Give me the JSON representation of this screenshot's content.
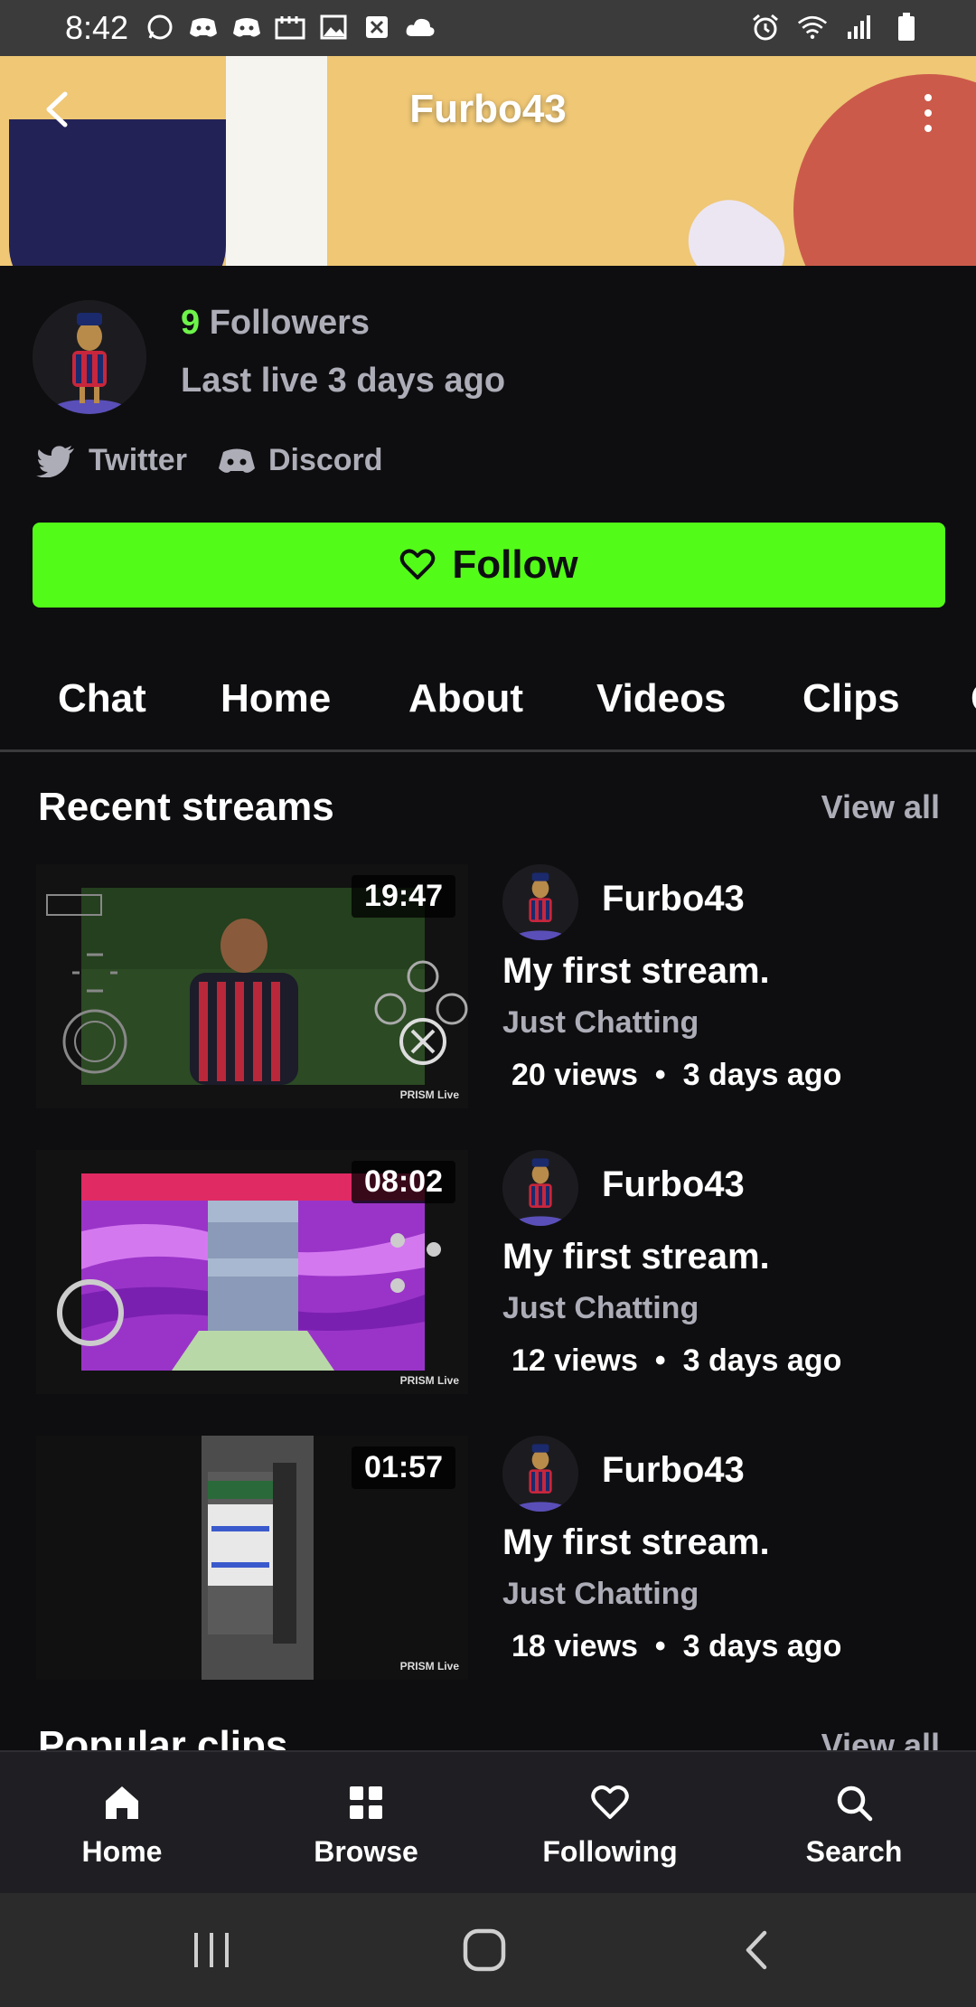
{
  "status_bar": {
    "time": "8:42"
  },
  "header": {
    "title": "Furbo43"
  },
  "profile": {
    "followers_count": "9",
    "followers_label": "Followers",
    "last_live": "Last live 3 days ago",
    "socials": [
      {
        "label": "Twitter",
        "icon": "twitter-icon"
      },
      {
        "label": "Discord",
        "icon": "discord-icon"
      }
    ],
    "follow_label": "Follow"
  },
  "tabs": [
    {
      "label": "Chat"
    },
    {
      "label": "Home"
    },
    {
      "label": "About"
    },
    {
      "label": "Videos"
    },
    {
      "label": "Clips"
    },
    {
      "label": "C"
    }
  ],
  "recent_streams": {
    "title": "Recent streams",
    "view_all": "View all",
    "items": [
      {
        "duration": "19:47",
        "channel": "Furbo43",
        "title": "My first stream.",
        "category": "Just Chatting",
        "views": "20 views",
        "age": "3 days ago",
        "watermark": "PRISM Live"
      },
      {
        "duration": "08:02",
        "channel": "Furbo43",
        "title": "My first stream.",
        "category": "Just Chatting",
        "views": "12 views",
        "age": "3 days ago",
        "watermark": "PRISM Live"
      },
      {
        "duration": "01:57",
        "channel": "Furbo43",
        "title": "My first stream.",
        "category": "Just Chatting",
        "views": "18 views",
        "age": "3 days ago",
        "watermark": "PRISM Live"
      }
    ]
  },
  "next_section": {
    "title": "Popular clips",
    "view_all": "View all"
  },
  "bottom_nav": [
    {
      "label": "Home",
      "icon": "home-icon"
    },
    {
      "label": "Browse",
      "icon": "browse-icon"
    },
    {
      "label": "Following",
      "icon": "heart-icon"
    },
    {
      "label": "Search",
      "icon": "search-icon"
    }
  ],
  "colors": {
    "accent": "#53fc18",
    "background": "#0e0e10",
    "muted_text": "#adadb8",
    "banner": "#efc775"
  }
}
